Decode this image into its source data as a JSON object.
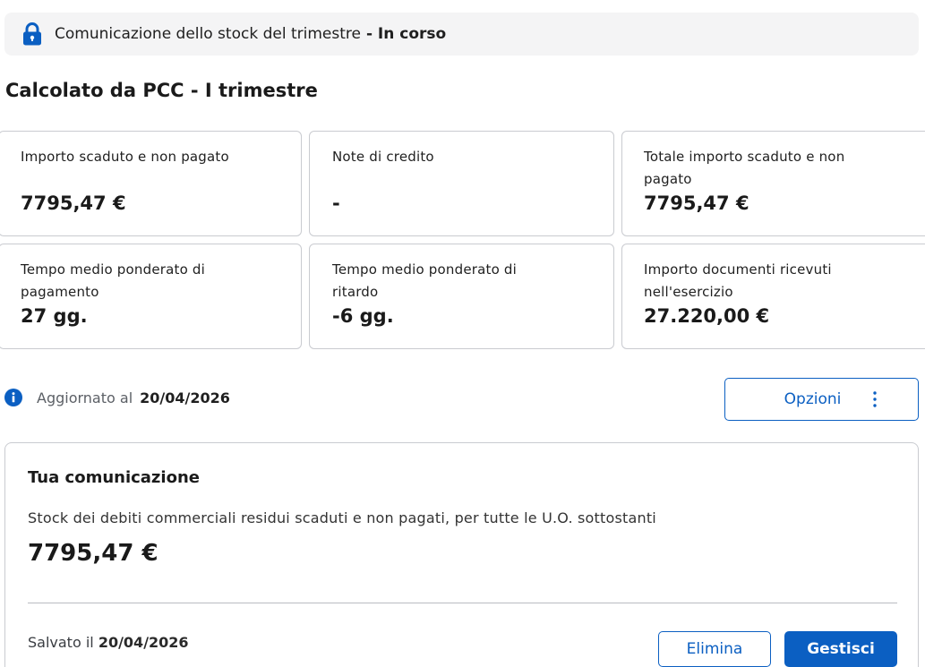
{
  "banner": {
    "icon": "lock-icon",
    "text": "Comunicazione dello stock del trimestre",
    "status": "- In corso"
  },
  "title": "Calcolato da PCC - I trimestre",
  "cards": [
    {
      "label": "Importo scaduto e non pagato",
      "value": "7795,47 €"
    },
    {
      "label": "Note di credito",
      "value": "-"
    },
    {
      "label": "Totale importo scaduto e non pagato",
      "value": "7795,47 €"
    },
    {
      "label": "Tempo medio ponderato di pagamento",
      "value": "27 gg."
    },
    {
      "label": "Tempo medio ponderato di ritardo",
      "value": "-6 gg."
    },
    {
      "label": "Importo documenti ricevuti nell'esercizio",
      "value": "27.220,00 €"
    }
  ],
  "updated": {
    "icon": "info-icon",
    "label": "Aggiornato al",
    "date": "20/04/2026"
  },
  "options_button": {
    "label": "Opzioni",
    "icon": "kebab-menu-icon"
  },
  "communication": {
    "title": "Tua comunicazione",
    "description": "Stock dei debiti commerciali residui scaduti e non pagati, per tutte le U.O. sottostanti",
    "amount": "7795,47 €",
    "saved_label": "Salvato il",
    "saved_date": "20/04/2026",
    "delete_label": "Elimina",
    "manage_label": "Gestisci"
  },
  "colors": {
    "primary": "#0b5fc2",
    "banner_bg": "#f4f4f5",
    "border": "#c9cbd0"
  }
}
